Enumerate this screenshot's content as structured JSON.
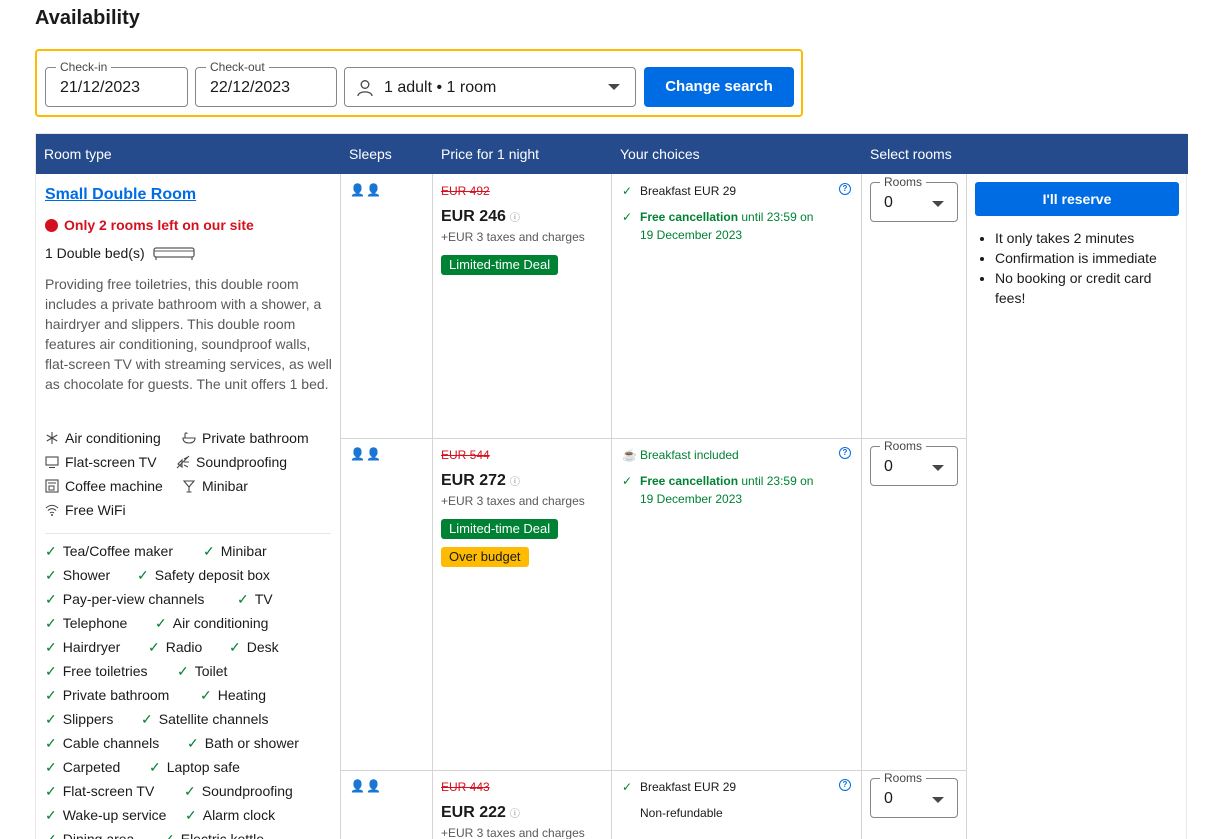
{
  "page_title": "Availability",
  "search": {
    "checkin_label": "Check-in",
    "checkin_value": "21/12/2023",
    "checkout_label": "Check-out",
    "checkout_value": "22/12/2023",
    "occupancy": "1 adult • 1 room",
    "change_button": "Change search"
  },
  "table_headers": {
    "room_type": "Room type",
    "sleeps": "Sleeps",
    "price": "Price for 1 night",
    "choices": "Your choices",
    "select": "Select rooms"
  },
  "room": {
    "name": "Small Double Room",
    "scarcity": "Only 2 rooms left on our site",
    "bed": "1 Double bed(s)",
    "description": "Providing free toiletries, this double room includes a private bathroom with a shower, a hairdryer and slippers. This double room features air conditioning, soundproof walls, flat-screen TV with streaming services, as well as chocolate for guests. The unit offers 1 bed.",
    "facilities": [
      {
        "label": "Air conditioning",
        "icon": "snowflake-icon"
      },
      {
        "label": "Private bathroom",
        "icon": "bath-icon"
      },
      {
        "label": "Flat-screen TV",
        "icon": "tv-icon"
      },
      {
        "label": "Soundproofing",
        "icon": "soundproof-icon"
      },
      {
        "label": "Coffee machine",
        "icon": "coffee-machine-icon"
      },
      {
        "label": "Minibar",
        "icon": "cocktail-icon"
      },
      {
        "label": "Free WiFi",
        "icon": "wifi-icon"
      }
    ],
    "amenities": [
      [
        "Tea/Coffee maker",
        "Minibar"
      ],
      [
        "Shower",
        "Safety deposit box"
      ],
      [
        "Pay-per-view channels",
        "TV"
      ],
      [
        "Telephone",
        "Air conditioning"
      ],
      [
        "Hairdryer",
        "Radio",
        "Desk"
      ],
      [
        "Free toiletries",
        "Toilet"
      ],
      [
        "Private bathroom",
        "Heating"
      ],
      [
        "Slippers",
        "Satellite channels"
      ],
      [
        "Cable channels",
        "Bath or shower"
      ],
      [
        "Carpeted",
        "Laptop safe"
      ],
      [
        "Flat-screen TV",
        "Soundproofing"
      ],
      [
        "Wake-up service",
        "Alarm clock"
      ],
      [
        "Dining area",
        "Electric kettle"
      ]
    ]
  },
  "options": [
    {
      "original_price": "EUR 492",
      "price": "EUR 246",
      "taxes": "+EUR 3 taxes and charges",
      "badges": [
        "Limited-time Deal"
      ],
      "choice_1": "Breakfast EUR 29",
      "choice_2_bold": "Free cancellation",
      "choice_2_rest": " until 23:59 on",
      "choice_2_line2": "19 December 2023",
      "rooms_label": "Rooms",
      "rooms_value": "0"
    },
    {
      "original_price": "EUR 544",
      "price": "EUR 272",
      "taxes": "+EUR 3 taxes and charges",
      "badges": [
        "Limited-time Deal",
        "Over budget"
      ],
      "choice_1": "Breakfast included",
      "choice_2_bold": "Free cancellation",
      "choice_2_rest": " until 23:59 on",
      "choice_2_line2": "19 December 2023",
      "rooms_label": "Rooms",
      "rooms_value": "0"
    },
    {
      "original_price": "EUR 443",
      "price": "EUR 222",
      "taxes": "+EUR 3 taxes and charges",
      "choice_1": "Breakfast EUR 29",
      "choice_2": "Non-refundable",
      "rooms_label": "Rooms",
      "rooms_value": "0"
    }
  ],
  "reserve": {
    "button": "I'll reserve",
    "bullets": [
      "It only takes 2 minutes",
      "Confirmation is immediate",
      "No booking or credit card fees!"
    ]
  },
  "colors": {
    "header_bg": "#264b8c",
    "primary": "#006ce4",
    "deal": "#008234",
    "budget": "#febb02",
    "alert": "#d4111e"
  }
}
